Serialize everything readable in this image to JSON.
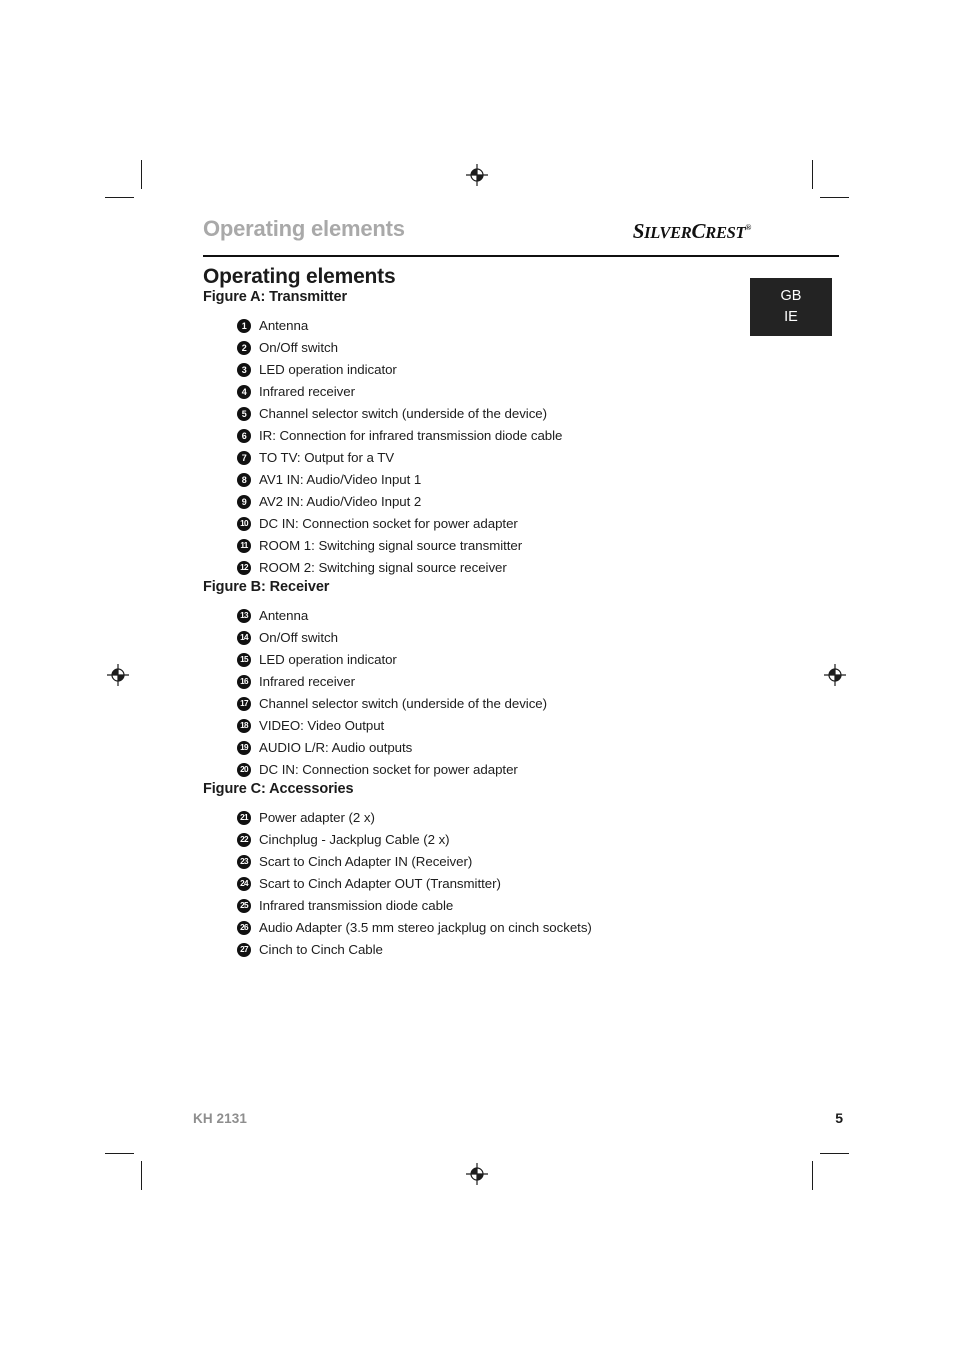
{
  "document": {
    "running_header": "Operating elements",
    "brand_logo": "SILVERCREST",
    "brand_registered_mark": "®",
    "language_badge": {
      "line1": "GB",
      "line2": "IE"
    },
    "main_title": "Operating elements",
    "footer": {
      "model": "KH 2131",
      "page_number": "5"
    }
  },
  "sections": [
    {
      "heading": "Figure A: Transmitter",
      "items": [
        {
          "num": "1",
          "text": "Antenna"
        },
        {
          "num": "2",
          "text": "On/Off switch"
        },
        {
          "num": "3",
          "text": "LED operation indicator"
        },
        {
          "num": "4",
          "text": "Infrared receiver"
        },
        {
          "num": "5",
          "text": "Channel selector switch (underside of the device)"
        },
        {
          "num": "6",
          "text": "IR: Connection for infrared transmission diode cable"
        },
        {
          "num": "7",
          "text": "TO TV: Output for a TV"
        },
        {
          "num": "8",
          "text": "AV1 IN: Audio/Video Input 1"
        },
        {
          "num": "9",
          "text": "AV2 IN: Audio/Video Input 2"
        },
        {
          "num": "10",
          "text": "DC IN: Connection socket for power adapter"
        },
        {
          "num": "11",
          "text": "ROOM 1: Switching signal source transmitter"
        },
        {
          "num": "12",
          "text": "ROOM 2: Switching signal source receiver"
        }
      ]
    },
    {
      "heading": "Figure B: Receiver",
      "items": [
        {
          "num": "13",
          "text": "Antenna"
        },
        {
          "num": "14",
          "text": "On/Off switch"
        },
        {
          "num": "15",
          "text": "LED operation indicator"
        },
        {
          "num": "16",
          "text": "Infrared receiver"
        },
        {
          "num": "17",
          "text": "Channel selector switch (underside of the device)"
        },
        {
          "num": "18",
          "text": "VIDEO: Video Output"
        },
        {
          "num": "19",
          "text": "AUDIO L/R: Audio outputs"
        },
        {
          "num": "20",
          "text": "DC IN: Connection socket for power adapter"
        }
      ]
    },
    {
      "heading": "Figure C: Accessories",
      "items": [
        {
          "num": "21",
          "text": "Power adapter (2 x)"
        },
        {
          "num": "22",
          "text": "Cinchplug - Jackplug Cable (2 x)"
        },
        {
          "num": "23",
          "text": "Scart to Cinch Adapter IN (Receiver)"
        },
        {
          "num": "24",
          "text": "Scart to Cinch Adapter OUT (Transmitter)"
        },
        {
          "num": "25",
          "text": "Infrared transmission diode cable"
        },
        {
          "num": "26",
          "text": "Audio Adapter (3.5 mm stereo jackplug on cinch sockets)"
        },
        {
          "num": "27",
          "text": "Cinch to Cinch Cable"
        }
      ]
    }
  ],
  "print_marks": {
    "registration_mark_name": "registration-target-icon",
    "crop_mark_name": "crop-mark"
  }
}
